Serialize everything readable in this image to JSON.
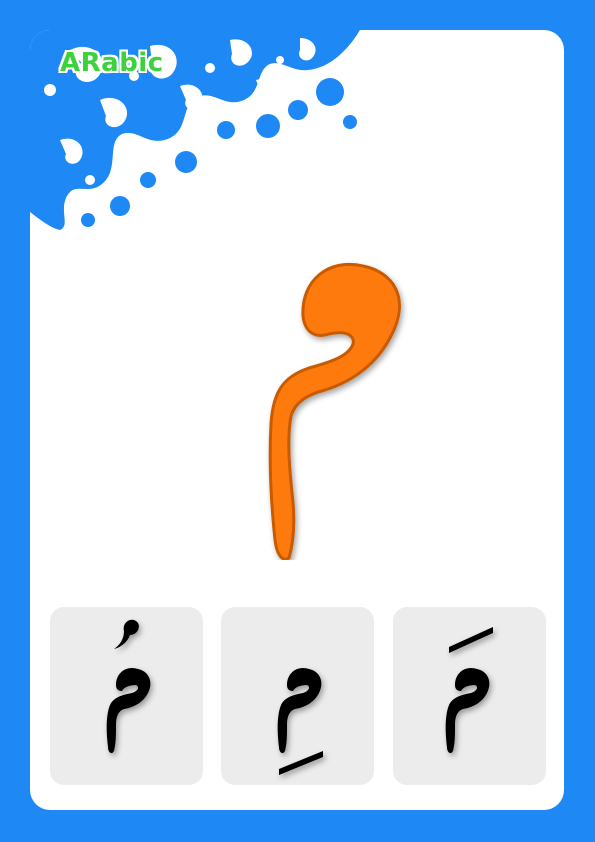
{
  "brand": {
    "label": "ARabic"
  },
  "colors": {
    "frame": "#1e88f5",
    "card": "#ffffff",
    "ornament": "#1e88f5",
    "letter_fill": "#ff7a0a",
    "letter_stroke": "#c85a00",
    "tile": "#ececec",
    "mark": "#000000",
    "brand_text": "#3bd23b"
  },
  "letter": {
    "char": "م"
  },
  "variants": [
    {
      "char": "مُ",
      "diacritic": "damma"
    },
    {
      "char": "مِ",
      "diacritic": "kasra"
    },
    {
      "char": "مَ",
      "diacritic": "fatha"
    }
  ]
}
